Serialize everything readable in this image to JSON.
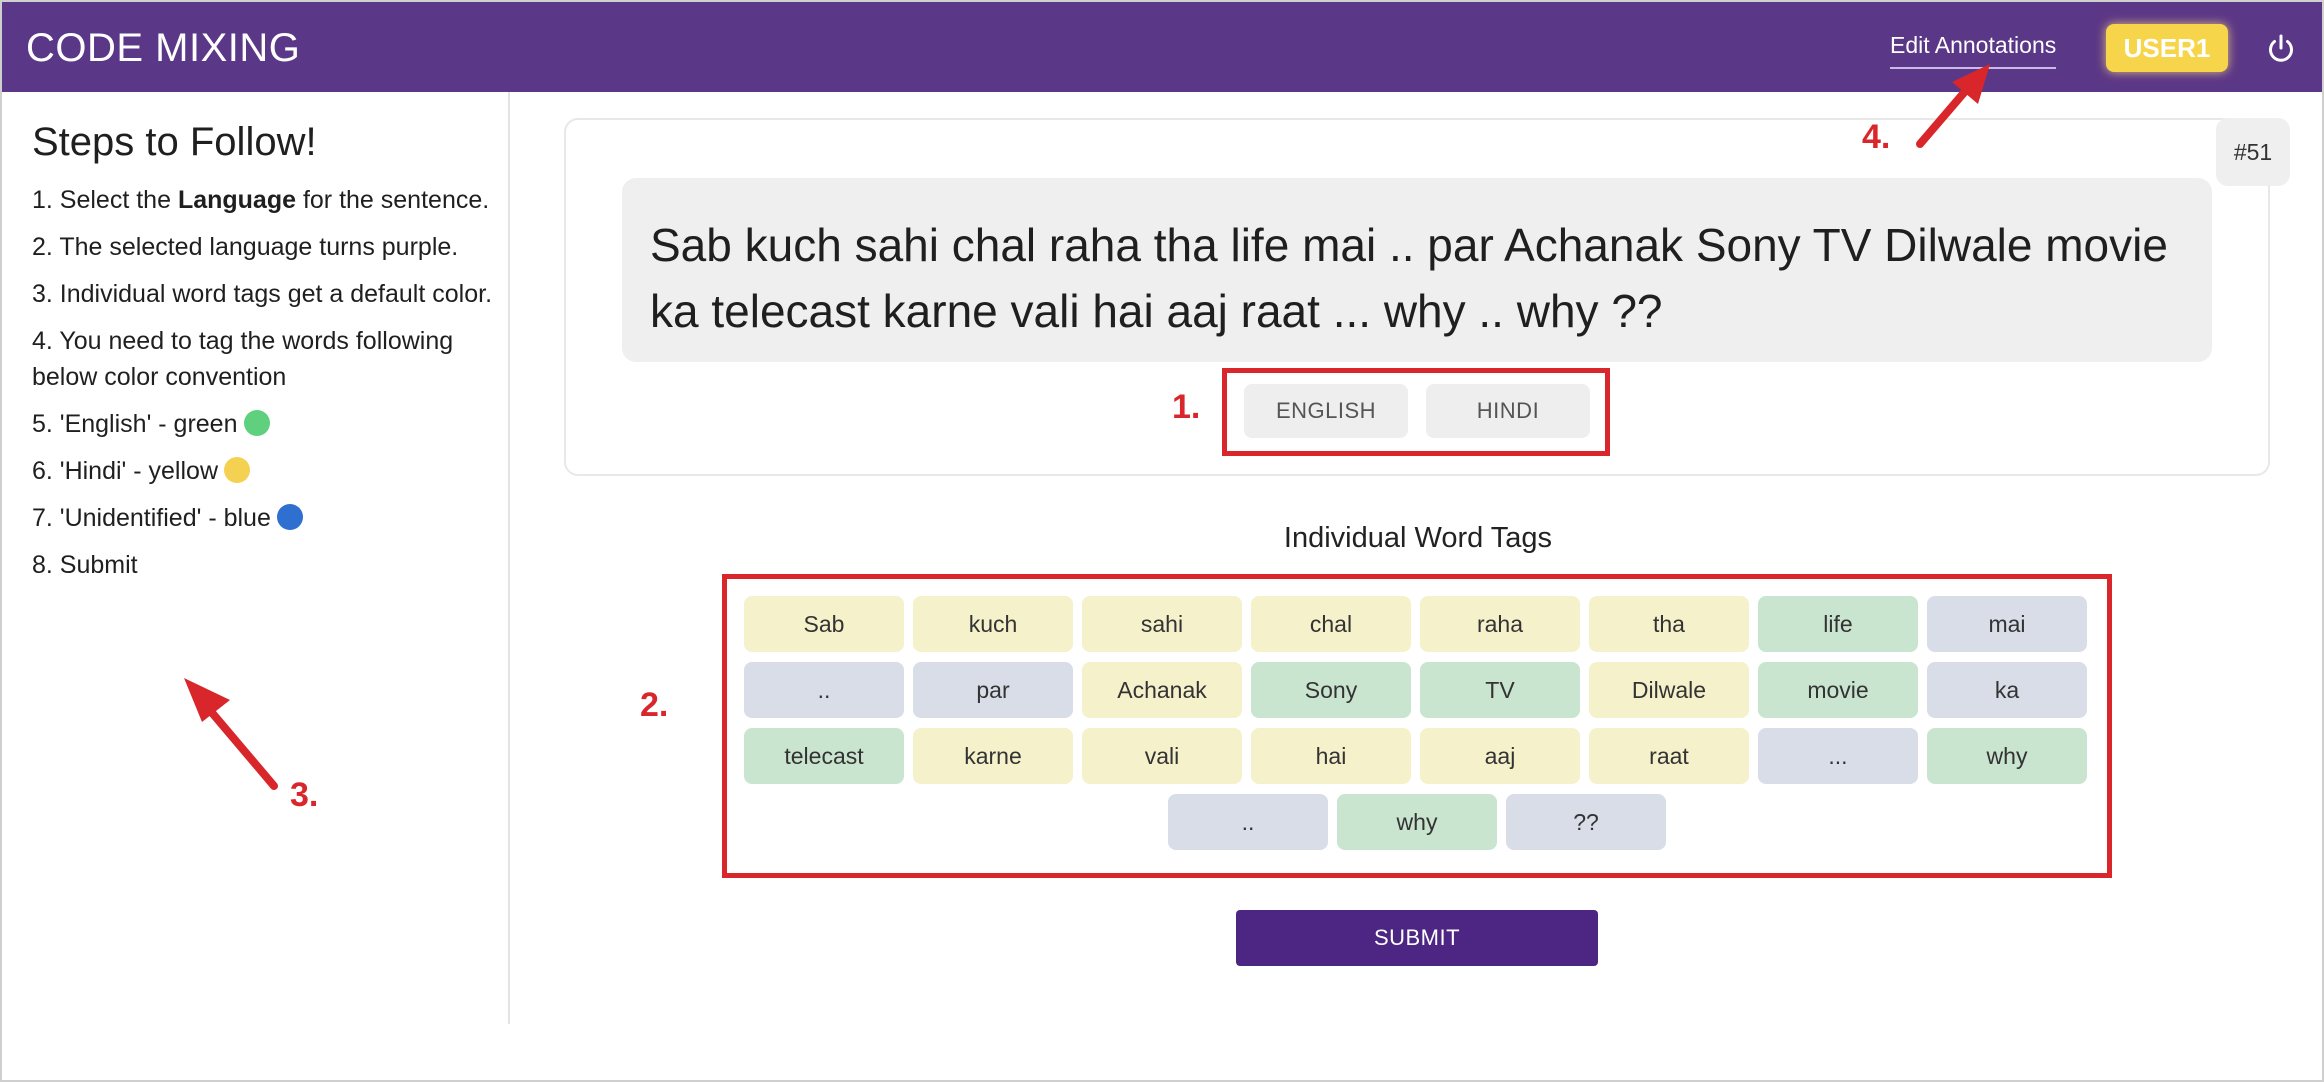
{
  "header": {
    "app_title": "CODE MIXING",
    "edit_link": "Edit Annotations",
    "user": "USER1",
    "icons": {
      "power": "power-icon"
    },
    "colors": {
      "bar": "#5b3787",
      "user_badge": "#f7d54a"
    }
  },
  "sidebar": {
    "title": "Steps to Follow!",
    "steps": [
      {
        "before": "1. Select the ",
        "bold": "Language",
        "after": " for the sentence."
      },
      {
        "text": "2. The selected language turns purple."
      },
      {
        "text": "3. Individual word tags get a default color."
      },
      {
        "text": "4. You need to tag the words following below color convention"
      },
      {
        "text": "5. 'English' - green",
        "dot_color": "#5fd07e"
      },
      {
        "text": "6. 'Hindi' - yellow",
        "dot_color": "#f5d152"
      },
      {
        "text": "7. 'Unidentified' - blue",
        "dot_color": "#2f6fd0"
      },
      {
        "text": "8. Submit"
      }
    ]
  },
  "sentence_card": {
    "id_badge": "#51",
    "sentence": "Sab kuch sahi chal raha tha life mai .. par Achanak Sony TV Dilwale movie ka telecast karne vali hai aaj raat ... why .. why ??",
    "languages": [
      "ENGLISH",
      "HINDI"
    ]
  },
  "word_tags": {
    "title": "Individual Word Tags",
    "tag_colors": {
      "english": "#c9e4cf",
      "hindi": "#f5f1cb",
      "unidentified": "#d8dde8"
    },
    "rows": [
      [
        {
          "word": "Sab",
          "lang": "hindi"
        },
        {
          "word": "kuch",
          "lang": "hindi"
        },
        {
          "word": "sahi",
          "lang": "hindi"
        },
        {
          "word": "chal",
          "lang": "hindi"
        },
        {
          "word": "raha",
          "lang": "hindi"
        },
        {
          "word": "tha",
          "lang": "hindi"
        },
        {
          "word": "life",
          "lang": "english"
        },
        {
          "word": "mai",
          "lang": "unidentified"
        }
      ],
      [
        {
          "word": "..",
          "lang": "unidentified"
        },
        {
          "word": "par",
          "lang": "unidentified"
        },
        {
          "word": "Achanak",
          "lang": "hindi"
        },
        {
          "word": "Sony",
          "lang": "english"
        },
        {
          "word": "TV",
          "lang": "english"
        },
        {
          "word": "Dilwale",
          "lang": "hindi"
        },
        {
          "word": "movie",
          "lang": "english"
        },
        {
          "word": "ka",
          "lang": "unidentified"
        }
      ],
      [
        {
          "word": "telecast",
          "lang": "english"
        },
        {
          "word": "karne",
          "lang": "hindi"
        },
        {
          "word": "vali",
          "lang": "hindi"
        },
        {
          "word": "hai",
          "lang": "hindi"
        },
        {
          "word": "aaj",
          "lang": "hindi"
        },
        {
          "word": "raat",
          "lang": "hindi"
        },
        {
          "word": "...",
          "lang": "unidentified"
        },
        {
          "word": "why",
          "lang": "english"
        }
      ],
      [
        {
          "word": "..",
          "lang": "unidentified"
        },
        {
          "word": "why",
          "lang": "english"
        },
        {
          "word": "??",
          "lang": "unidentified"
        }
      ]
    ],
    "submit": "SUBMIT"
  },
  "annotations": {
    "markers": [
      "1.",
      "2.",
      "3.",
      "4."
    ],
    "color": "#d9262b"
  }
}
